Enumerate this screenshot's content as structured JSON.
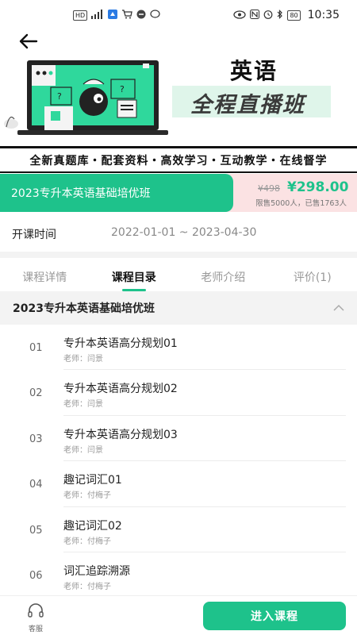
{
  "status_bar": {
    "left_icons": [
      "hd-icon",
      "5g-signal-icon",
      "signal-icon",
      "notification-icon",
      "cart-icon",
      "app-icon",
      "chat-icon"
    ],
    "right_icons": [
      "eye-icon",
      "nfc-icon",
      "alarm-icon",
      "bluetooth-icon"
    ],
    "battery": "80",
    "time": "10:35"
  },
  "banner": {
    "title_1": "英语",
    "title_2": "全程直播班",
    "features": "全新真题库・配套资料・高效学习・互动教学・在线督学"
  },
  "course": {
    "name": "2023专升本英语基础培优班",
    "price_original": "¥498",
    "price_current": "¥298.00",
    "enrollment": "限售5000人，已售1763人"
  },
  "schedule": {
    "label": "开课时间",
    "value": "2022-01-01 ~ 2023-04-30"
  },
  "tabs": [
    {
      "label": "课程详情",
      "active": false
    },
    {
      "label": "课程目录",
      "active": true
    },
    {
      "label": "老师介绍",
      "active": false
    },
    {
      "label": "评价(1)",
      "active": false
    }
  ],
  "chapter": {
    "title": "2023专升本英语基础培优班"
  },
  "lessons": [
    {
      "num": "01",
      "name": "专升本英语高分规划01",
      "teacher": "老师：闫景"
    },
    {
      "num": "02",
      "name": "专升本英语高分规划02",
      "teacher": "老师：闫景"
    },
    {
      "num": "03",
      "name": "专升本英语高分规划03",
      "teacher": "老师：闫景"
    },
    {
      "num": "04",
      "name": "趣记词汇01",
      "teacher": "老师：付梅子"
    },
    {
      "num": "05",
      "name": "趣记词汇02",
      "teacher": "老师：付梅子"
    },
    {
      "num": "06",
      "name": "词汇追踪溯源",
      "teacher": "老师：付梅子"
    }
  ],
  "bottom": {
    "service_label": "客服",
    "enroll_label": "进入课程"
  },
  "colors": {
    "accent": "#1ec28b",
    "price_bg": "#fbe2e3",
    "title_highlight": "#dff5ea"
  }
}
